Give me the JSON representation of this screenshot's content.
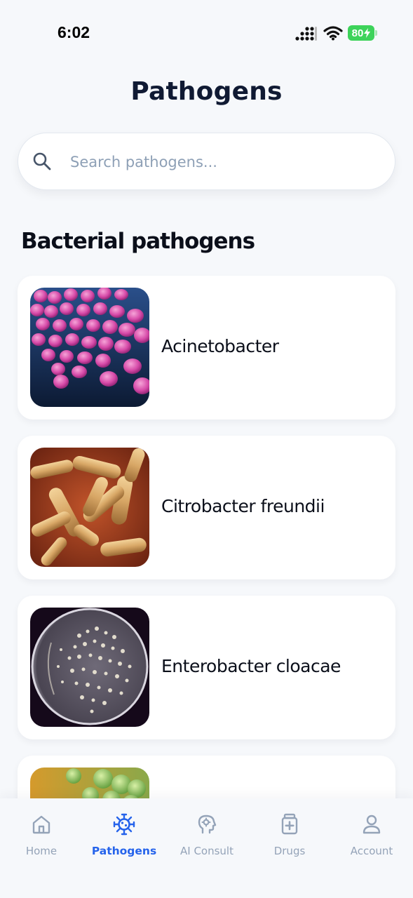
{
  "status": {
    "time": "6:02",
    "battery": "80"
  },
  "header": {
    "title": "Pathogens"
  },
  "search": {
    "placeholder": "Search pathogens..."
  },
  "section": {
    "title": "Bacterial pathogens"
  },
  "pathogens": [
    {
      "name": "Acinetobacter",
      "image": "pink-cocci-micrograph"
    },
    {
      "name": "Citrobacter freundii",
      "image": "rod-bacteria-micrograph"
    },
    {
      "name": "Enterobacter cloacae",
      "image": "petri-dish-colonies"
    },
    {
      "name": "",
      "image": "green-cocci-micrograph"
    }
  ],
  "tabs": [
    {
      "label": "Home",
      "icon": "home-icon",
      "active": false
    },
    {
      "label": "Pathogens",
      "icon": "virus-icon",
      "active": true
    },
    {
      "label": "AI Consult",
      "icon": "brain-icon",
      "active": false
    },
    {
      "label": "Drugs",
      "icon": "medicine-icon",
      "active": false
    },
    {
      "label": "Account",
      "icon": "user-icon",
      "active": false
    }
  ],
  "colors": {
    "accent": "#2563eb",
    "inactive": "#94a3b8",
    "background": "#f6f8fb",
    "battery": "#3dd35a"
  }
}
